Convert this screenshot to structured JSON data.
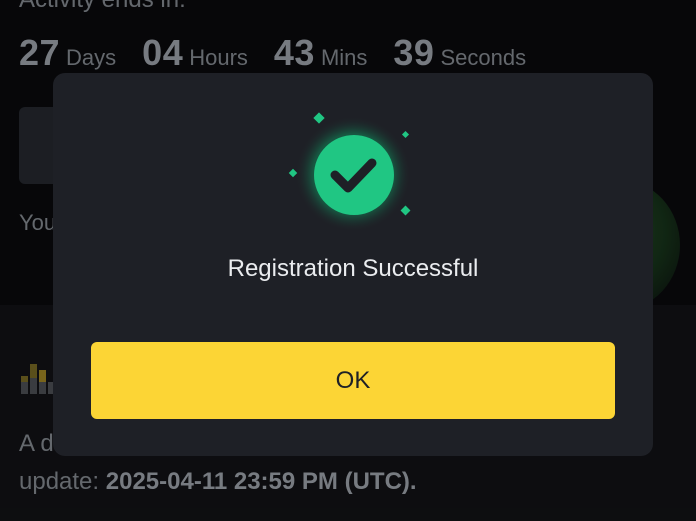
{
  "background": {
    "activity_label": "Activity ends in:",
    "countdown": [
      {
        "value": "27",
        "unit": "Days"
      },
      {
        "value": "04",
        "unit": "Hours"
      },
      {
        "value": "43",
        "unit": "Mins"
      },
      {
        "value": "39",
        "unit": "Seconds"
      }
    ],
    "partial_text_you": "You",
    "paragraph_partial": "A d",
    "paragraph_line2_prefix": "update: ",
    "paragraph_date": "2025-04-11 23:59 PM (UTC)."
  },
  "modal": {
    "icon": "checkmark-circle-icon",
    "title": "Registration Successful",
    "ok_label": "OK"
  },
  "colors": {
    "accent_yellow": "#fcd535",
    "success_green": "#2ebd85",
    "modal_bg": "#1e2026"
  }
}
